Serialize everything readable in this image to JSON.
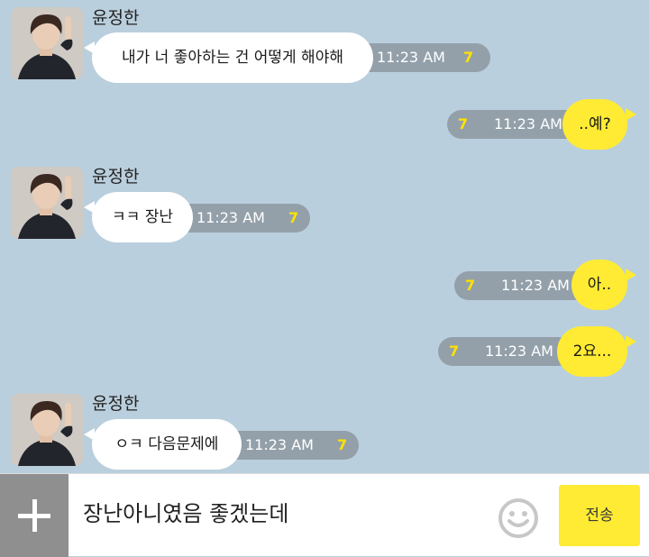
{
  "messages": [
    {
      "sender": "윤정한",
      "text": "내가 너 좋아하는 건 어떻게 해야해",
      "time": "11:23 AM",
      "count": "7"
    },
    {
      "text": "..예?",
      "time": "11:23 AM",
      "count": "7"
    },
    {
      "sender": "윤정한",
      "text": "ㅋㅋ 장난",
      "time": "11:23 AM",
      "count": "7"
    },
    {
      "text": "아..",
      "time": "11:23 AM",
      "count": "7"
    },
    {
      "text": "2요...",
      "time": "11:23 AM",
      "count": "7"
    },
    {
      "sender": "윤정한",
      "text": "ㅇㅋ 다음문제에",
      "time": "11:23 AM",
      "count": "7"
    }
  ],
  "composer": {
    "text": "장난아니였음 좋겠는데",
    "send_label": "전송",
    "plus_icon": "plus-icon",
    "emoji_icon": "smiley-icon"
  },
  "colors": {
    "background": "#bacfdd",
    "my_bubble": "#ffeb33",
    "their_bubble": "#ffffff",
    "unread_count": "#ffe200"
  }
}
